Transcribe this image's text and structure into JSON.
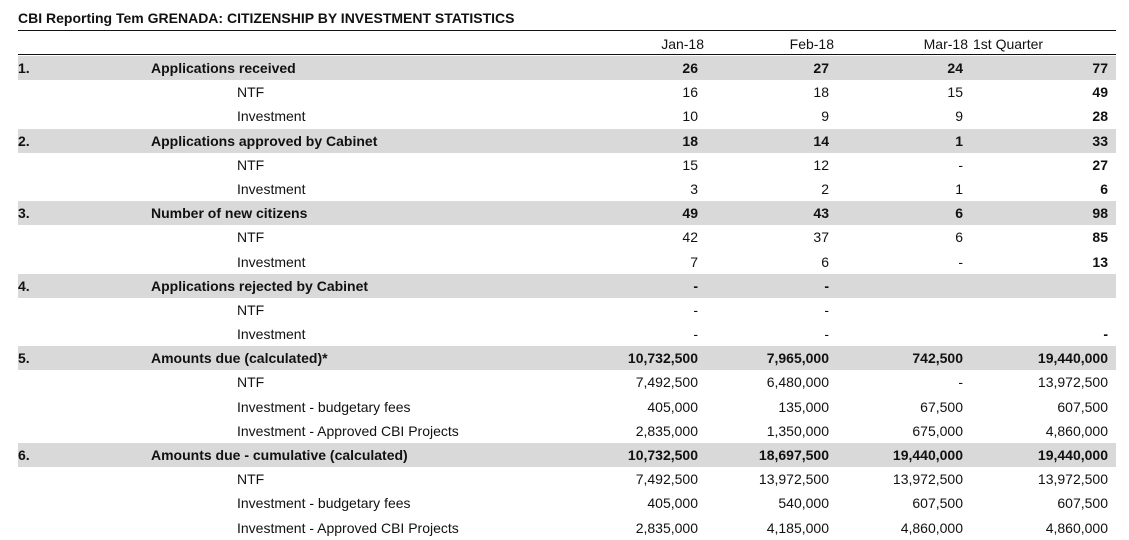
{
  "title": "CBI Reporting Tem GRENADA: CITIZENSHIP BY INVESTMENT STATISTICS",
  "columns": {
    "jan": "Jan-18",
    "feb": "Feb-18",
    "mar": "Mar-18",
    "q1": "1st Quarter"
  },
  "rows": [
    {
      "kind": "section",
      "num": "1.",
      "label": "Applications received",
      "jan": "26",
      "feb": "27",
      "mar": "24",
      "q1": "77"
    },
    {
      "kind": "sub",
      "label": "NTF",
      "jan": "16",
      "feb": "18",
      "mar": "15",
      "q1": "49"
    },
    {
      "kind": "sub",
      "label": "Investment",
      "jan": "10",
      "feb": "9",
      "mar": "9",
      "q1": "28"
    },
    {
      "kind": "section",
      "num": "2.",
      "label": "Applications approved by Cabinet",
      "jan": "18",
      "feb": "14",
      "mar": "1",
      "q1": "33"
    },
    {
      "kind": "sub",
      "label": "NTF",
      "jan": "15",
      "feb": "12",
      "mar": "-",
      "q1": "27"
    },
    {
      "kind": "sub",
      "label": "Investment",
      "jan": "3",
      "feb": "2",
      "mar": "1",
      "q1": "6"
    },
    {
      "kind": "section",
      "num": "3.",
      "label": "Number of new citizens",
      "jan": "49",
      "feb": "43",
      "mar": "6",
      "q1": "98"
    },
    {
      "kind": "sub",
      "label": "NTF",
      "jan": "42",
      "feb": "37",
      "mar": "6",
      "q1": "85"
    },
    {
      "kind": "sub",
      "label": "Investment",
      "jan": "7",
      "feb": "6",
      "mar": "-",
      "q1": "13"
    },
    {
      "kind": "section",
      "num": "4.",
      "label": "Applications rejected by Cabinet",
      "jan": "-",
      "feb": "-",
      "mar": "",
      "q1": ""
    },
    {
      "kind": "sub",
      "label": "NTF",
      "jan": "-",
      "feb": "-",
      "mar": "",
      "q1": ""
    },
    {
      "kind": "sub",
      "label": "Investment",
      "jan": "-",
      "feb": "-",
      "mar": "",
      "q1": "-"
    },
    {
      "kind": "section",
      "amount": true,
      "num": "5.",
      "label": "Amounts due (calculated)*",
      "jan": "10,732,500",
      "feb": "7,965,000",
      "mar": "742,500",
      "q1": "19,440,000"
    },
    {
      "kind": "sub",
      "amount": true,
      "label": "NTF",
      "jan": "7,492,500",
      "feb": "6,480,000",
      "mar": "-",
      "q1": "13,972,500"
    },
    {
      "kind": "sub",
      "amount": true,
      "label": "Investment - budgetary fees",
      "jan": "405,000",
      "feb": "135,000",
      "mar": "67,500",
      "q1": "607,500"
    },
    {
      "kind": "sub",
      "amount": true,
      "label": "Investment - Approved CBI Projects",
      "jan": "2,835,000",
      "feb": "1,350,000",
      "mar": "675,000",
      "q1": "4,860,000"
    },
    {
      "kind": "section",
      "amount": true,
      "num": "6.",
      "label": "Amounts due - cumulative (calculated)",
      "jan": "10,732,500",
      "feb": "18,697,500",
      "mar": "19,440,000",
      "q1": "19,440,000"
    },
    {
      "kind": "sub",
      "amount": true,
      "label": "NTF",
      "jan": "7,492,500",
      "feb": "13,972,500",
      "mar": "13,972,500",
      "q1": "13,972,500"
    },
    {
      "kind": "sub",
      "amount": true,
      "label": "Investment - budgetary fees",
      "jan": "405,000",
      "feb": "540,000",
      "mar": "607,500",
      "q1": "607,500"
    },
    {
      "kind": "sub",
      "amount": true,
      "label": "Investment - Approved CBI Projects",
      "jan": "2,835,000",
      "feb": "4,185,000",
      "mar": "4,860,000",
      "q1": "4,860,000"
    }
  ]
}
